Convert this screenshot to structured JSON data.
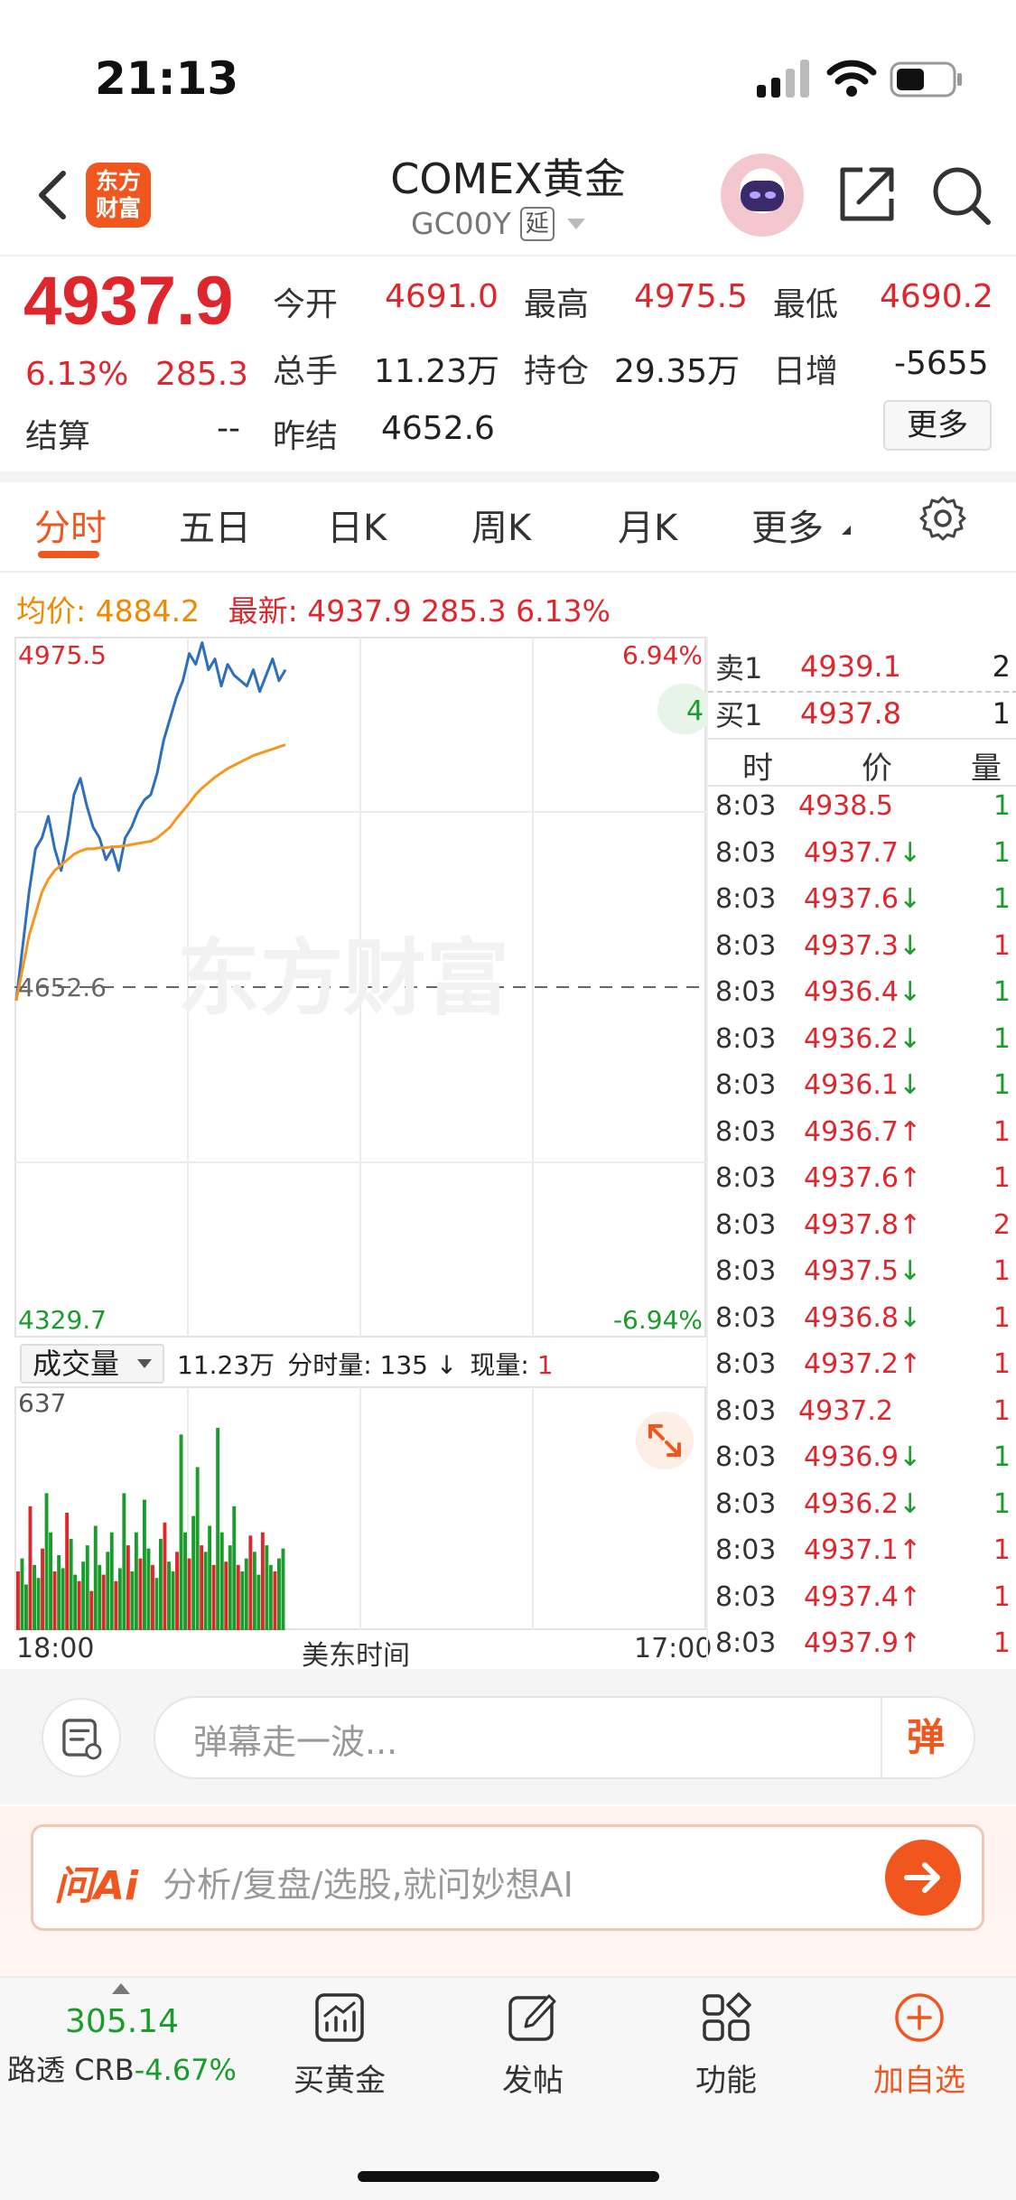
{
  "status_bar": {
    "time": "21:13"
  },
  "header": {
    "logo_text_1": "东方",
    "logo_text_2": "财富",
    "title": "COMEX黄金",
    "code": "GC00Y",
    "delay_badge": "延"
  },
  "quote": {
    "price": "4937.9",
    "change_pct": "6.13%",
    "change": "285.3",
    "open_label": "今开",
    "open": "4691.0",
    "high_label": "最高",
    "high": "4975.5",
    "low_label": "最低",
    "low": "4690.2",
    "volume_label": "总手",
    "volume": "11.23万",
    "oi_label": "持仓",
    "oi": "29.35万",
    "daily_inc_label": "日增",
    "daily_inc": "-5655",
    "settle_label": "结算",
    "settle": "--",
    "prev_settle_label": "昨结",
    "prev_settle": "4652.6",
    "more_button": "更多"
  },
  "tabs": [
    {
      "label": "分时",
      "active": true
    },
    {
      "label": "五日",
      "active": false
    },
    {
      "label": "日K",
      "active": false
    },
    {
      "label": "周K",
      "active": false
    },
    {
      "label": "月K",
      "active": false
    },
    {
      "label": "更多",
      "active": false
    }
  ],
  "infoline": {
    "avg_label": "均价:",
    "avg": "4884.2",
    "latest_label": "最新:",
    "latest": "4937.9",
    "latest_change": "285.3",
    "latest_pct": "6.13%"
  },
  "chart": {
    "y_max_label": "4975.5",
    "y_mid_label": "4652.6",
    "y_min_label": "4329.7",
    "pct_max_label": "6.94%",
    "pct_min_label": "-6.94%",
    "watermark": "东方财富",
    "bubble_text": "4",
    "x_start": "18:00",
    "x_mid": "美东时间",
    "x_end": "17:00"
  },
  "chart_data": {
    "type": "line",
    "title": "",
    "xlabel": "美东时间",
    "ylabel": "",
    "x_ticks": [
      "18:00",
      "17:00"
    ],
    "ylim": [
      4329.7,
      4975.5
    ],
    "reference_line": 4652.6,
    "series": [
      {
        "name": "",
        "color": "#2e6fbd",
        "values": [
          4640,
          4690,
          4740,
          4780,
          4790,
          4810,
          4780,
          4760,
          4790,
          4830,
          4845,
          4820,
          4800,
          4790,
          4770,
          4780,
          4760,
          4790,
          4800,
          4815,
          4825,
          4830,
          4850,
          4880,
          4900,
          4920,
          4935,
          4960,
          4950,
          4970,
          4945,
          4955,
          4930,
          4950,
          4940,
          4935,
          4930,
          4945,
          4925,
          4940,
          4955,
          4935,
          4945
        ]
      },
      {
        "name": "",
        "color": "#f5961e",
        "values": [
          4640,
          4670,
          4700,
          4720,
          4740,
          4752,
          4760,
          4765,
          4770,
          4775,
          4778,
          4780,
          4780,
          4781,
          4781,
          4782,
          4782,
          4783,
          4784,
          4785,
          4786,
          4787,
          4790,
          4795,
          4800,
          4808,
          4815,
          4822,
          4830,
          4836,
          4841,
          4846,
          4850,
          4854,
          4857,
          4860,
          4863,
          4866,
          4868,
          4870,
          4872,
          4874,
          4876
        ]
      }
    ]
  },
  "volume": {
    "selector": "成交量",
    "total": "11.23万",
    "tick_label": "分时量:",
    "tick_value": "135",
    "now_label": "现量:",
    "now_value": "1",
    "max_label": "637"
  },
  "volume_data": {
    "type": "bar",
    "ylim": [
      0,
      637
    ],
    "values": [
      180,
      220,
      140,
      380,
      200,
      160,
      250,
      420,
      300,
      180,
      230,
      190,
      360,
      280,
      170,
      150,
      210,
      260,
      120,
      320,
      200,
      170,
      240,
      300,
      150,
      190,
      420,
      260,
      180,
      300,
      220,
      400,
      250,
      200,
      160,
      280,
      330,
      210,
      180,
      240,
      600,
      300,
      220,
      350,
      500,
      260,
      240,
      320,
      200,
      620,
      300,
      210,
      260,
      380,
      200,
      180,
      220,
      290,
      240,
      170,
      300,
      260,
      200,
      180,
      220,
      250
    ],
    "colors_pattern": "alternating red/green"
  },
  "orderbook": {
    "sell_label": "卖1",
    "sell_price": "4939.1",
    "sell_qty": "2",
    "buy_label": "买1",
    "buy_price": "4937.8",
    "buy_qty": "1"
  },
  "ticks_header": {
    "time": "时",
    "price": "价",
    "qty": "量"
  },
  "ticks": [
    {
      "time": "8:03",
      "price": "4938.5",
      "arrow": "",
      "qty": "1",
      "qty_color": "green"
    },
    {
      "time": "8:03",
      "price": "4937.7",
      "arrow": "↓",
      "qty": "1",
      "qty_color": "green"
    },
    {
      "time": "8:03",
      "price": "4937.6",
      "arrow": "↓",
      "qty": "1",
      "qty_color": "green"
    },
    {
      "time": "8:03",
      "price": "4937.3",
      "arrow": "↓",
      "qty": "1",
      "qty_color": "red"
    },
    {
      "time": "8:03",
      "price": "4936.4",
      "arrow": "↓",
      "qty": "1",
      "qty_color": "green"
    },
    {
      "time": "8:03",
      "price": "4936.2",
      "arrow": "↓",
      "qty": "1",
      "qty_color": "green"
    },
    {
      "time": "8:03",
      "price": "4936.1",
      "arrow": "↓",
      "qty": "1",
      "qty_color": "green"
    },
    {
      "time": "8:03",
      "price": "4936.7",
      "arrow": "↑",
      "qty": "1",
      "qty_color": "red"
    },
    {
      "time": "8:03",
      "price": "4937.6",
      "arrow": "↑",
      "qty": "1",
      "qty_color": "red"
    },
    {
      "time": "8:03",
      "price": "4937.8",
      "arrow": "↑",
      "qty": "2",
      "qty_color": "red"
    },
    {
      "time": "8:03",
      "price": "4937.5",
      "arrow": "↓",
      "qty": "1",
      "qty_color": "red"
    },
    {
      "time": "8:03",
      "price": "4936.8",
      "arrow": "↓",
      "qty": "1",
      "qty_color": "red"
    },
    {
      "time": "8:03",
      "price": "4937.2",
      "arrow": "↑",
      "qty": "1",
      "qty_color": "red"
    },
    {
      "time": "8:03",
      "price": "4937.2",
      "arrow": "",
      "qty": "1",
      "qty_color": "red"
    },
    {
      "time": "8:03",
      "price": "4936.9",
      "arrow": "↓",
      "qty": "1",
      "qty_color": "green"
    },
    {
      "time": "8:03",
      "price": "4936.2",
      "arrow": "↓",
      "qty": "1",
      "qty_color": "green"
    },
    {
      "time": "8:03",
      "price": "4937.1",
      "arrow": "↑",
      "qty": "1",
      "qty_color": "red"
    },
    {
      "time": "8:03",
      "price": "4937.4",
      "arrow": "↑",
      "qty": "1",
      "qty_color": "red"
    },
    {
      "time": "8:03",
      "price": "4937.9",
      "arrow": "↑",
      "qty": "1",
      "qty_color": "red"
    }
  ],
  "danmaku": {
    "placeholder": "弹幕走一波...",
    "button": "弹"
  },
  "ai": {
    "logo": "问Ai",
    "placeholder": "分析/复盘/选股,就问妙想AI"
  },
  "bottom_nav": {
    "crb_value": "305.14",
    "crb_label": "路透 CRB",
    "crb_change": "-4.67%",
    "items": [
      {
        "label": "买黄金",
        "icon": "chart-up-icon"
      },
      {
        "label": "发帖",
        "icon": "edit-icon"
      },
      {
        "label": "功能",
        "icon": "grid-icon"
      },
      {
        "label": "加自选",
        "icon": "plus-circle-icon"
      }
    ]
  },
  "colors": {
    "accent": "#f0561d",
    "up": "#e0262d",
    "down": "#1a9c2a",
    "avg": "#ef8a00",
    "price_line": "#2e6fbd"
  }
}
